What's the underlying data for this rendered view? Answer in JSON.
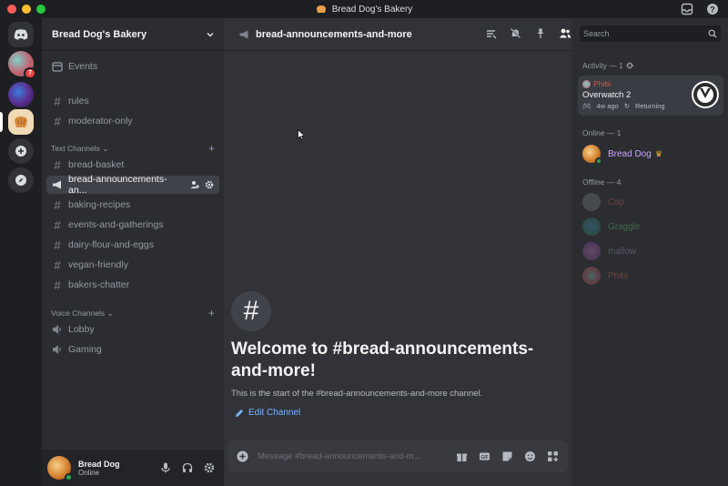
{
  "window": {
    "title": "Bread Dog's Bakery"
  },
  "server": {
    "name": "Bread Dog's Bakery",
    "badge_count": "7",
    "events_label": "Events",
    "channels_top": [
      {
        "name": "rules"
      },
      {
        "name": "moderator-only"
      }
    ],
    "text_category": "Text Channels",
    "text_channels": [
      {
        "name": "bread-basket"
      },
      {
        "name": "bread-announcements-an..."
      },
      {
        "name": "baking-recipes"
      },
      {
        "name": "events-and-gatherings"
      },
      {
        "name": "dairy-flour-and-eggs"
      },
      {
        "name": "vegan-friendly"
      },
      {
        "name": "bakers-chatter"
      }
    ],
    "voice_category": "Voice Channels",
    "voice_channels": [
      {
        "name": "Lobby"
      },
      {
        "name": "Gaming"
      }
    ]
  },
  "user": {
    "name": "Bread Dog",
    "status": "Online"
  },
  "channel": {
    "name": "bread-announcements-and-more",
    "welcome_title": "Welcome to #bread-announcements-and-more!",
    "welcome_sub": "This is the start of the #bread-announcements-and-more channel.",
    "edit_label": "Edit Channel",
    "composer_placeholder": "Message #bread-announcements-and-m..."
  },
  "members": {
    "search_placeholder": "Search",
    "activity_header": "Activity — 1",
    "activity": {
      "user": "Phibi",
      "game": "Overwatch 2",
      "time": "4w ago",
      "status": "Returning"
    },
    "online_header": "Online — 1",
    "online": [
      {
        "name": "Bread Dog"
      }
    ],
    "offline_header": "Offline — 4",
    "offline": [
      {
        "name": "Cap"
      },
      {
        "name": "Graggle"
      },
      {
        "name": "mallow"
      },
      {
        "name": "Phibi"
      }
    ]
  },
  "colors": {
    "accent": "#5865f2",
    "online": "#23a55a",
    "link": "#7ab4ff",
    "danger": "#f23f42"
  }
}
